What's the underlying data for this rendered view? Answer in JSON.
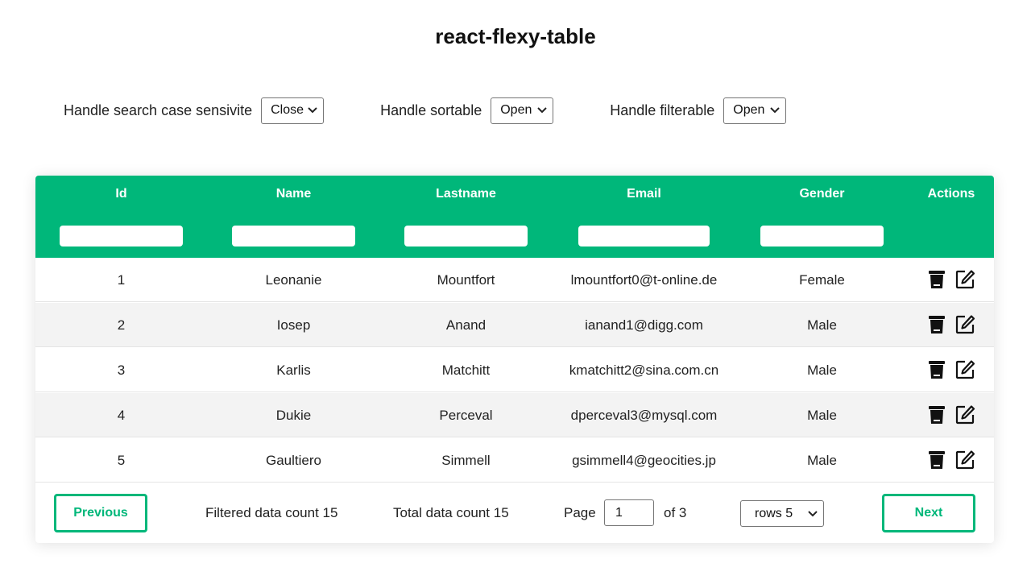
{
  "title": "react-flexy-table",
  "controls": [
    {
      "label": "Handle search case sensivite",
      "value": "Close"
    },
    {
      "label": "Handle sortable",
      "value": "Open"
    },
    {
      "label": "Handle filterable",
      "value": "Open"
    }
  ],
  "table": {
    "headers": [
      "Id",
      "Name",
      "Lastname",
      "Email",
      "Gender",
      "Actions"
    ],
    "rows": [
      {
        "id": "1",
        "name": "Leonanie",
        "lastname": "Mountfort",
        "email": "lmountfort0@t-online.de",
        "gender": "Female"
      },
      {
        "id": "2",
        "name": "Iosep",
        "lastname": "Anand",
        "email": "ianand1@digg.com",
        "gender": "Male"
      },
      {
        "id": "3",
        "name": "Karlis",
        "lastname": "Matchitt",
        "email": "kmatchitt2@sina.com.cn",
        "gender": "Male"
      },
      {
        "id": "4",
        "name": "Dukie",
        "lastname": "Perceval",
        "email": "dperceval3@mysql.com",
        "gender": "Male"
      },
      {
        "id": "5",
        "name": "Gaultiero",
        "lastname": "Simmell",
        "email": "gsimmell4@geocities.jp",
        "gender": "Male"
      }
    ],
    "actions": [
      "trash-icon",
      "edit-icon"
    ]
  },
  "footer": {
    "previous_label": "Previous",
    "filtered_count": "Filtered data count 15",
    "total_count": "Total data count 15",
    "page_label": "Page",
    "page_value": "1",
    "of_label": "of 3",
    "rows_value": "rows 5",
    "next_label": "Next"
  },
  "colors": {
    "accent": "#00b77a"
  }
}
